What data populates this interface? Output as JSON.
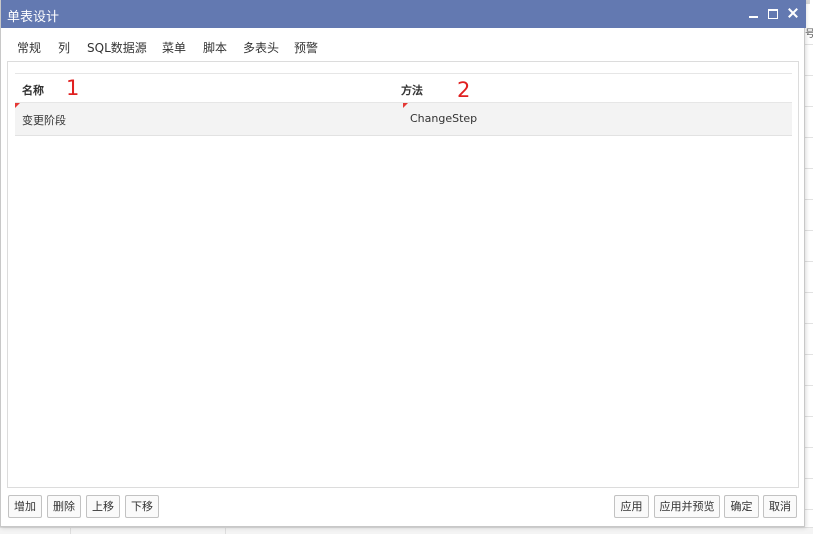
{
  "window": {
    "title": "单表设计"
  },
  "tabs": [
    {
      "label": "常规"
    },
    {
      "label": "列"
    },
    {
      "label": "SQL数据源"
    },
    {
      "label": "菜单",
      "active": true
    },
    {
      "label": "脚本"
    },
    {
      "label": "多表头"
    },
    {
      "label": "预警"
    }
  ],
  "grid": {
    "columns": [
      "名称",
      "方法"
    ],
    "rows": [
      {
        "name": "变更阶段",
        "method": "ChangeStep"
      }
    ]
  },
  "annotations": [
    "1",
    "2"
  ],
  "buttons_left": [
    "增加",
    "删除",
    "上移",
    "下移"
  ],
  "buttons_right": [
    "应用",
    "应用并预览",
    "确定",
    "取消"
  ],
  "background": {
    "right_glyph": "号"
  },
  "colors": {
    "titlebar": "#6379b1",
    "annotation": "#e02020",
    "dirty_marker": "#e53935"
  }
}
